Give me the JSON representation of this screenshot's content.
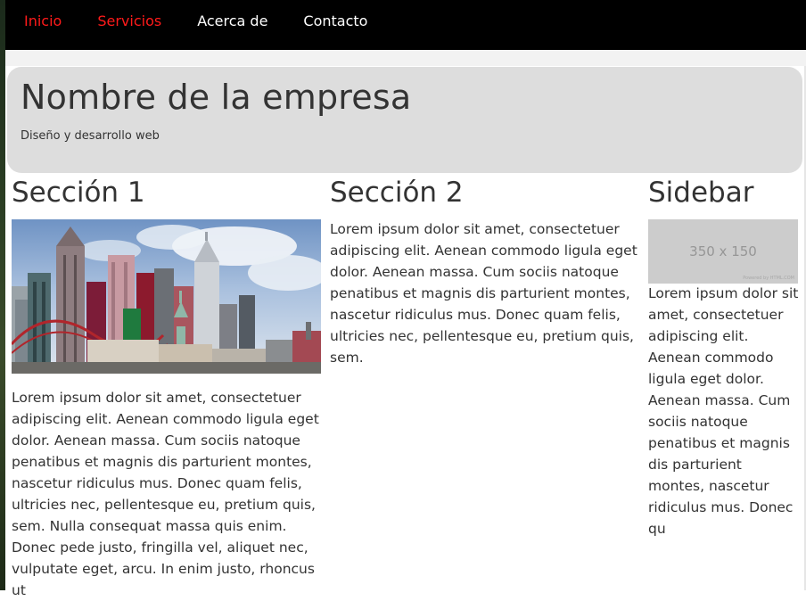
{
  "nav": {
    "items": [
      {
        "label": "Inicio",
        "active": true
      },
      {
        "label": "Servicios",
        "active": true
      },
      {
        "label": "Acerca de",
        "active": false
      },
      {
        "label": "Contacto",
        "active": false
      }
    ],
    "active_color": "#ff1a1a",
    "background": "#000000"
  },
  "hero": {
    "title": "Nombre de la empresa",
    "subtitle": "Diseño y desarrollo web"
  },
  "section1": {
    "title": "Sección 1",
    "image": "city-skyline",
    "text": "Lorem ipsum dolor sit amet, consectetuer adipiscing elit. Aenean commodo ligula eget dolor. Aenean massa. Cum sociis natoque penatibus et magnis dis parturient montes, nascetur ridiculus mus. Donec quam felis, ultricies nec, pellentesque eu, pretium quis, sem. Nulla consequat massa quis enim. Donec pede justo, fringilla vel, aliquet nec, vulputate eget, arcu. In enim justo, rhoncus ut"
  },
  "section2": {
    "title": "Sección 2",
    "text": "Lorem ipsum dolor sit amet, consectetuer adipiscing elit. Aenean commodo ligula eget dolor. Aenean massa. Cum sociis natoque penatibus et magnis dis parturient montes, nascetur ridiculus mus. Donec quam felis, ultricies nec, pellentesque eu, pretium quis, sem."
  },
  "sidebar": {
    "title": "Sidebar",
    "placeholder_label": "350 x 150",
    "placeholder_powered": "Powered by HTML.COM",
    "text": "Lorem ipsum dolor sit amet, consectetuer adipiscing elit. Aenean commodo ligula eget dolor. Aenean massa. Cum sociis natoque penatibus et magnis dis parturient montes, nascetur ridiculus mus. Donec qu"
  }
}
